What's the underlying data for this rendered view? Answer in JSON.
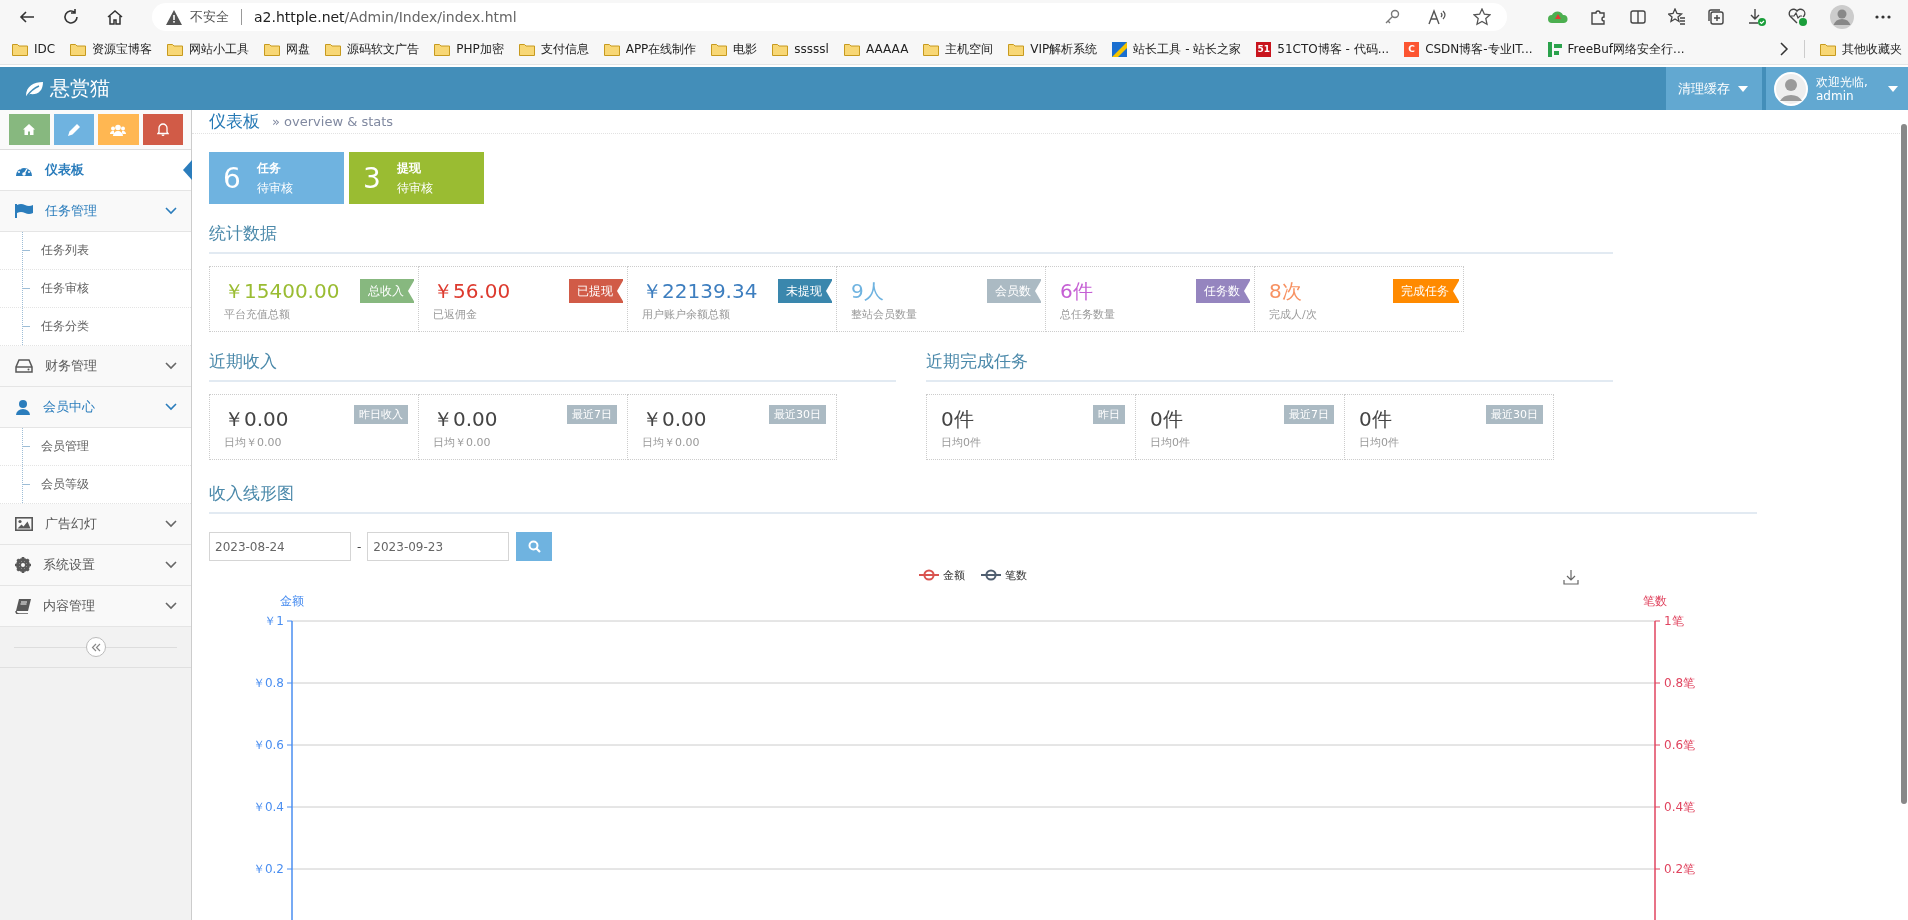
{
  "browser": {
    "security": "不安全",
    "url_host": "a2.httple.net",
    "url_path": "/Admin/Index/index.html"
  },
  "bookmarks": [
    {
      "label": "IDC",
      "kind": "folder"
    },
    {
      "label": "资源宝博客",
      "kind": "folder"
    },
    {
      "label": "网站小工具",
      "kind": "folder"
    },
    {
      "label": "网盘",
      "kind": "folder"
    },
    {
      "label": "源码软文广告",
      "kind": "folder"
    },
    {
      "label": "PHP加密",
      "kind": "folder"
    },
    {
      "label": "支付信息",
      "kind": "folder"
    },
    {
      "label": "APP在线制作",
      "kind": "folder"
    },
    {
      "label": "电影",
      "kind": "folder"
    },
    {
      "label": "sssssl",
      "kind": "folder"
    },
    {
      "label": "AAAAA",
      "kind": "folder"
    },
    {
      "label": "主机空间",
      "kind": "folder"
    },
    {
      "label": "VIP解析系统",
      "kind": "folder"
    },
    {
      "label": "站长工具 - 站长之家",
      "kind": "stripes"
    },
    {
      "label": "51CTO博客 - 代码...",
      "kind": "tile",
      "icon_text": "51",
      "color": "#c9151e"
    },
    {
      "label": "CSDN博客-专业IT...",
      "kind": "tile",
      "icon_text": "C",
      "color": "#fc5531"
    },
    {
      "label": "FreeBuf网络安全行...",
      "kind": "bars"
    }
  ],
  "other_bookmarks": "其他收藏夹",
  "header": {
    "brand": "悬赏猫",
    "clear_cache": "清理缓存",
    "greeting": "欢迎光临,",
    "user": "admin"
  },
  "shortcuts": [
    {
      "kind": "home",
      "color": "#87b87f"
    },
    {
      "kind": "pencil",
      "color": "#6fb3e0"
    },
    {
      "kind": "users",
      "color": "#ffb752"
    },
    {
      "kind": "bell",
      "color": "#d15b47"
    }
  ],
  "menu": [
    {
      "label": "仪表板",
      "kind": "dashboard",
      "selected": true
    },
    {
      "label": "任务管理",
      "kind": "flag",
      "expanded": true,
      "children": [
        {
          "label": "任务列表",
          "selected": false
        },
        {
          "label": "任务审核",
          "selected": false
        },
        {
          "label": "任务分类",
          "selected": false
        }
      ]
    },
    {
      "label": "财务管理",
      "kind": "drive",
      "expanded": false
    },
    {
      "label": "会员中心",
      "kind": "user",
      "expanded": true,
      "children": [
        {
          "label": "会员管理",
          "selected": false
        },
        {
          "label": "会员等级",
          "selected": false
        }
      ]
    },
    {
      "label": "广告幻灯",
      "kind": "picture",
      "expanded": false
    },
    {
      "label": "系统设置",
      "kind": "cog",
      "expanded": false
    },
    {
      "label": "内容管理",
      "kind": "book",
      "expanded": false
    }
  ],
  "page": {
    "title": "仪表板",
    "subtitle": "» overview & stats"
  },
  "pending": [
    {
      "count": "6",
      "title": "任务",
      "subtitle": "待审核",
      "color": "#6fb3e0"
    },
    {
      "count": "3",
      "title": "提现",
      "subtitle": "待审核",
      "color": "#9abc32"
    }
  ],
  "stats": {
    "title": "统计数据",
    "items": [
      {
        "value": "￥15400.00",
        "caption": "平台充值总额",
        "color": "#9abc32",
        "badge": {
          "text": "总收入",
          "color": "#87b87f"
        }
      },
      {
        "value": "￥56.00",
        "caption": "已返佣金",
        "color": "#dd3a2e",
        "badge": {
          "text": "已提现",
          "color": "#d15b47"
        }
      },
      {
        "value": "￥22139.34",
        "caption": "用户账户余额总额",
        "color": "#3d7ebf",
        "badge": {
          "text": "未提现",
          "color": "#3a87ad"
        }
      },
      {
        "value": "9人",
        "caption": "整站会员数量",
        "color": "#6fb3e0",
        "badge": {
          "text": "会员数",
          "color": "#abbac3"
        }
      },
      {
        "value": "6件",
        "caption": "总任务数量",
        "color": "#c55fd4",
        "badge": {
          "text": "任务数",
          "color": "#9585bf"
        }
      },
      {
        "value": "8次",
        "caption": "完成人/次",
        "color": "#f79263",
        "badge": {
          "text": "完成任务",
          "color": "#ff8a00"
        }
      }
    ]
  },
  "recent_income": {
    "title": "近期收入",
    "items": [
      {
        "value": "￥0.00",
        "caption": "日均￥0.00",
        "badge": "昨日收入"
      },
      {
        "value": "￥0.00",
        "caption": "日均￥0.00",
        "badge": "最近7日"
      },
      {
        "value": "￥0.00",
        "caption": "日均￥0.00",
        "badge": "最近30日"
      }
    ]
  },
  "recent_tasks": {
    "title": "近期完成任务",
    "items": [
      {
        "value": "0件",
        "caption": "日均0件",
        "badge": "昨日"
      },
      {
        "value": "0件",
        "caption": "日均0件",
        "badge": "最近7日"
      },
      {
        "value": "0件",
        "caption": "日均0件",
        "badge": "最近30日"
      }
    ]
  },
  "income_chart": {
    "title": "收入线形图",
    "date_from": "2023-08-24",
    "separator": "-",
    "date_to": "2023-09-23",
    "right_axis": {
      "title": "笔数",
      "ticks": [
        "1笔",
        "0.8笔",
        "0.6笔",
        "0.4笔",
        "0.2笔"
      ]
    },
    "chart_data": {
      "type": "line",
      "ylabel": "金额",
      "ylim": [
        0,
        1
      ],
      "grid": true,
      "yticks": [
        {
          "value": 1,
          "label": "￥1"
        },
        {
          "value": 0.8,
          "label": "￥0.8"
        },
        {
          "value": 0.6,
          "label": "￥0.6"
        },
        {
          "value": 0.4,
          "label": "￥0.4"
        },
        {
          "value": 0.2,
          "label": "￥0.2"
        }
      ],
      "series": [
        {
          "name": "金额",
          "color": "#d9534f"
        },
        {
          "name": "笔数",
          "color": "#505f70"
        }
      ]
    }
  }
}
